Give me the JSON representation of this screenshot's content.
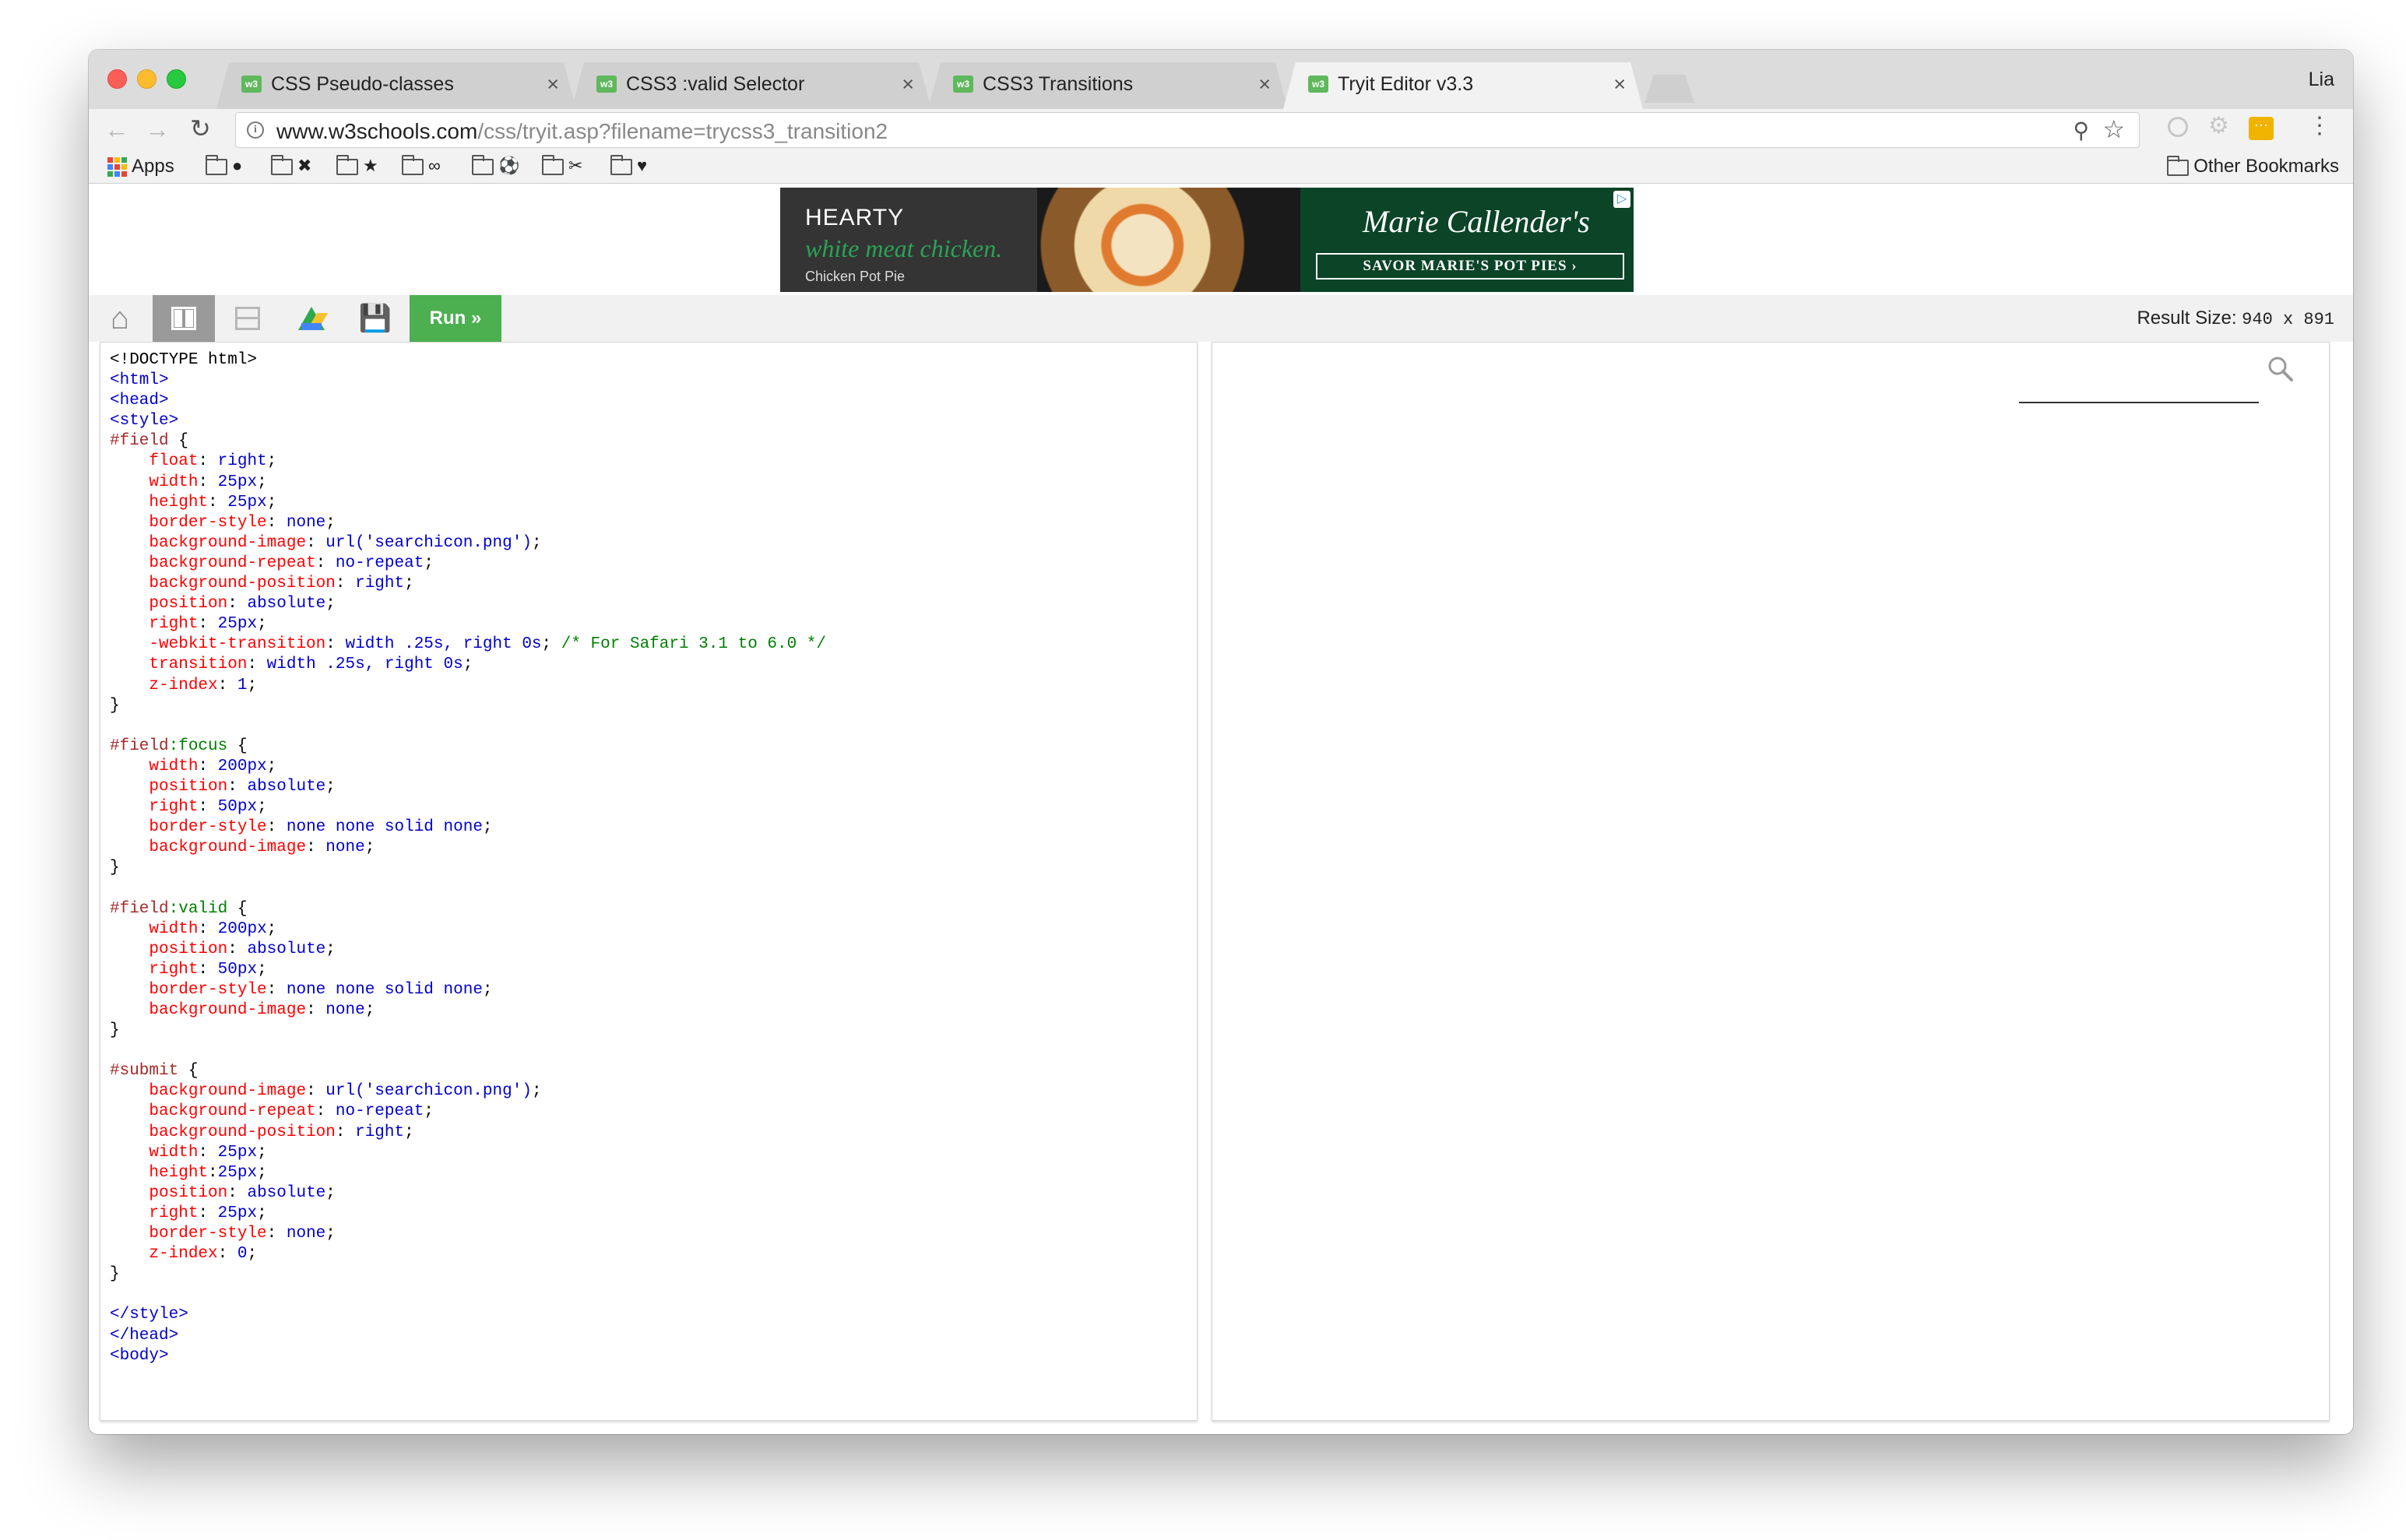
{
  "browser": {
    "tabs": [
      {
        "label": "CSS Pseudo-classes",
        "favicon": "w3",
        "close": "×"
      },
      {
        "label": "CSS3 :valid Selector",
        "favicon": "w3",
        "close": "×"
      },
      {
        "label": "CSS3 Transitions",
        "favicon": "w3",
        "close": "×"
      },
      {
        "label": "Tryit Editor v3.3",
        "favicon": "w3",
        "close": "×"
      }
    ],
    "active_tab": 3,
    "profile": "Lia",
    "url_host": "www.w3schools.com",
    "url_path": "/css/tryit.asp?filename=trycss3_transition2",
    "bookmarks": {
      "apps_label": "Apps",
      "folders": [
        {
          "glyph": "●"
        },
        {
          "glyph": "✖"
        },
        {
          "glyph": "★"
        },
        {
          "glyph": "∞"
        },
        {
          "glyph": "⚽"
        },
        {
          "glyph": "✂"
        },
        {
          "glyph": "♥"
        }
      ],
      "other_label": "Other Bookmarks"
    }
  },
  "ad": {
    "line1": "HEARTY",
    "line2": "white meat chicken.",
    "line3": "Chicken Pot Pie",
    "brand": "Marie Callender's",
    "cta": "SAVOR MARIE'S POT PIES ›"
  },
  "tryit": {
    "run_label": "Run »",
    "result_size_label": "Result Size:",
    "result_size_value": "940 x 891"
  },
  "code_lines": [
    [
      {
        "t": "<!DOCTYPE html>",
        "c": "plain"
      }
    ],
    [
      {
        "t": "<html>",
        "c": "tag"
      }
    ],
    [
      {
        "t": "<head>",
        "c": "tag"
      }
    ],
    [
      {
        "t": "<style>",
        "c": "tag"
      }
    ],
    [
      {
        "t": "#field",
        "c": "sel"
      },
      {
        "t": " {",
        "c": "plain"
      }
    ],
    [
      {
        "t": "    ",
        "c": "plain"
      },
      {
        "t": "float",
        "c": "prop"
      },
      {
        "t": ": ",
        "c": "plain"
      },
      {
        "t": "right",
        "c": "val"
      },
      {
        "t": ";",
        "c": "plain"
      }
    ],
    [
      {
        "t": "    ",
        "c": "plain"
      },
      {
        "t": "width",
        "c": "prop"
      },
      {
        "t": ": ",
        "c": "plain"
      },
      {
        "t": "25px",
        "c": "val"
      },
      {
        "t": ";",
        "c": "plain"
      }
    ],
    [
      {
        "t": "    ",
        "c": "plain"
      },
      {
        "t": "height",
        "c": "prop"
      },
      {
        "t": ": ",
        "c": "plain"
      },
      {
        "t": "25px",
        "c": "val"
      },
      {
        "t": ";",
        "c": "plain"
      }
    ],
    [
      {
        "t": "    ",
        "c": "plain"
      },
      {
        "t": "border-style",
        "c": "prop"
      },
      {
        "t": ": ",
        "c": "plain"
      },
      {
        "t": "none",
        "c": "val"
      },
      {
        "t": ";",
        "c": "plain"
      }
    ],
    [
      {
        "t": "    ",
        "c": "plain"
      },
      {
        "t": "background-image",
        "c": "prop"
      },
      {
        "t": ": ",
        "c": "plain"
      },
      {
        "t": "url('searchicon.png')",
        "c": "val"
      },
      {
        "t": ";",
        "c": "plain"
      }
    ],
    [
      {
        "t": "    ",
        "c": "plain"
      },
      {
        "t": "background-repeat",
        "c": "prop"
      },
      {
        "t": ": ",
        "c": "plain"
      },
      {
        "t": "no-repeat",
        "c": "val"
      },
      {
        "t": ";",
        "c": "plain"
      }
    ],
    [
      {
        "t": "    ",
        "c": "plain"
      },
      {
        "t": "background-position",
        "c": "prop"
      },
      {
        "t": ": ",
        "c": "plain"
      },
      {
        "t": "right",
        "c": "val"
      },
      {
        "t": ";",
        "c": "plain"
      }
    ],
    [
      {
        "t": "    ",
        "c": "plain"
      },
      {
        "t": "position",
        "c": "prop"
      },
      {
        "t": ": ",
        "c": "plain"
      },
      {
        "t": "absolute",
        "c": "val"
      },
      {
        "t": ";",
        "c": "plain"
      }
    ],
    [
      {
        "t": "    ",
        "c": "plain"
      },
      {
        "t": "right",
        "c": "prop"
      },
      {
        "t": ": ",
        "c": "plain"
      },
      {
        "t": "25px",
        "c": "val"
      },
      {
        "t": ";",
        "c": "plain"
      }
    ],
    [
      {
        "t": "    ",
        "c": "plain"
      },
      {
        "t": "-webkit-transition",
        "c": "prop"
      },
      {
        "t": ": ",
        "c": "plain"
      },
      {
        "t": "width .25s, right 0s",
        "c": "val"
      },
      {
        "t": "; ",
        "c": "plain"
      },
      {
        "t": "/* For Safari 3.1 to 6.0 */",
        "c": "com"
      }
    ],
    [
      {
        "t": "    ",
        "c": "plain"
      },
      {
        "t": "transition",
        "c": "prop"
      },
      {
        "t": ": ",
        "c": "plain"
      },
      {
        "t": "width .25s, right 0s",
        "c": "val"
      },
      {
        "t": ";",
        "c": "plain"
      }
    ],
    [
      {
        "t": "    ",
        "c": "plain"
      },
      {
        "t": "z-index",
        "c": "prop"
      },
      {
        "t": ": ",
        "c": "plain"
      },
      {
        "t": "1",
        "c": "val"
      },
      {
        "t": ";",
        "c": "plain"
      }
    ],
    [
      {
        "t": "}",
        "c": "plain"
      }
    ],
    [
      {
        "t": "",
        "c": "plain"
      }
    ],
    [
      {
        "t": "#field",
        "c": "sel"
      },
      {
        "t": ":focus",
        "c": "com"
      },
      {
        "t": " {",
        "c": "plain"
      }
    ],
    [
      {
        "t": "    ",
        "c": "plain"
      },
      {
        "t": "width",
        "c": "prop"
      },
      {
        "t": ": ",
        "c": "plain"
      },
      {
        "t": "200px",
        "c": "val"
      },
      {
        "t": ";",
        "c": "plain"
      }
    ],
    [
      {
        "t": "    ",
        "c": "plain"
      },
      {
        "t": "position",
        "c": "prop"
      },
      {
        "t": ": ",
        "c": "plain"
      },
      {
        "t": "absolute",
        "c": "val"
      },
      {
        "t": ";",
        "c": "plain"
      }
    ],
    [
      {
        "t": "    ",
        "c": "plain"
      },
      {
        "t": "right",
        "c": "prop"
      },
      {
        "t": ": ",
        "c": "plain"
      },
      {
        "t": "50px",
        "c": "val"
      },
      {
        "t": ";",
        "c": "plain"
      }
    ],
    [
      {
        "t": "    ",
        "c": "plain"
      },
      {
        "t": "border-style",
        "c": "prop"
      },
      {
        "t": ": ",
        "c": "plain"
      },
      {
        "t": "none none solid none",
        "c": "val"
      },
      {
        "t": ";",
        "c": "plain"
      }
    ],
    [
      {
        "t": "    ",
        "c": "plain"
      },
      {
        "t": "background-image",
        "c": "prop"
      },
      {
        "t": ": ",
        "c": "plain"
      },
      {
        "t": "none",
        "c": "val"
      },
      {
        "t": ";",
        "c": "plain"
      }
    ],
    [
      {
        "t": "}",
        "c": "plain"
      }
    ],
    [
      {
        "t": "",
        "c": "plain"
      }
    ],
    [
      {
        "t": "#field",
        "c": "sel"
      },
      {
        "t": ":valid",
        "c": "com"
      },
      {
        "t": " {",
        "c": "plain"
      }
    ],
    [
      {
        "t": "    ",
        "c": "plain"
      },
      {
        "t": "width",
        "c": "prop"
      },
      {
        "t": ": ",
        "c": "plain"
      },
      {
        "t": "200px",
        "c": "val"
      },
      {
        "t": ";",
        "c": "plain"
      }
    ],
    [
      {
        "t": "    ",
        "c": "plain"
      },
      {
        "t": "position",
        "c": "prop"
      },
      {
        "t": ": ",
        "c": "plain"
      },
      {
        "t": "absolute",
        "c": "val"
      },
      {
        "t": ";",
        "c": "plain"
      }
    ],
    [
      {
        "t": "    ",
        "c": "plain"
      },
      {
        "t": "right",
        "c": "prop"
      },
      {
        "t": ": ",
        "c": "plain"
      },
      {
        "t": "50px",
        "c": "val"
      },
      {
        "t": ";",
        "c": "plain"
      }
    ],
    [
      {
        "t": "    ",
        "c": "plain"
      },
      {
        "t": "border-style",
        "c": "prop"
      },
      {
        "t": ": ",
        "c": "plain"
      },
      {
        "t": "none none solid none",
        "c": "val"
      },
      {
        "t": ";",
        "c": "plain"
      }
    ],
    [
      {
        "t": "    ",
        "c": "plain"
      },
      {
        "t": "background-image",
        "c": "prop"
      },
      {
        "t": ": ",
        "c": "plain"
      },
      {
        "t": "none",
        "c": "val"
      },
      {
        "t": ";",
        "c": "plain"
      }
    ],
    [
      {
        "t": "}",
        "c": "plain"
      }
    ],
    [
      {
        "t": "",
        "c": "plain"
      }
    ],
    [
      {
        "t": "#submit",
        "c": "sel"
      },
      {
        "t": " {",
        "c": "plain"
      }
    ],
    [
      {
        "t": "    ",
        "c": "plain"
      },
      {
        "t": "background-image",
        "c": "prop"
      },
      {
        "t": ": ",
        "c": "plain"
      },
      {
        "t": "url('searchicon.png')",
        "c": "val"
      },
      {
        "t": ";",
        "c": "plain"
      }
    ],
    [
      {
        "t": "    ",
        "c": "plain"
      },
      {
        "t": "background-repeat",
        "c": "prop"
      },
      {
        "t": ": ",
        "c": "plain"
      },
      {
        "t": "no-repeat",
        "c": "val"
      },
      {
        "t": ";",
        "c": "plain"
      }
    ],
    [
      {
        "t": "    ",
        "c": "plain"
      },
      {
        "t": "background-position",
        "c": "prop"
      },
      {
        "t": ": ",
        "c": "plain"
      },
      {
        "t": "right",
        "c": "val"
      },
      {
        "t": ";",
        "c": "plain"
      }
    ],
    [
      {
        "t": "    ",
        "c": "plain"
      },
      {
        "t": "width",
        "c": "prop"
      },
      {
        "t": ": ",
        "c": "plain"
      },
      {
        "t": "25px",
        "c": "val"
      },
      {
        "t": ";",
        "c": "plain"
      }
    ],
    [
      {
        "t": "    ",
        "c": "plain"
      },
      {
        "t": "height",
        "c": "prop"
      },
      {
        "t": ":",
        "c": "plain"
      },
      {
        "t": "25px",
        "c": "val"
      },
      {
        "t": ";",
        "c": "plain"
      }
    ],
    [
      {
        "t": "    ",
        "c": "plain"
      },
      {
        "t": "position",
        "c": "prop"
      },
      {
        "t": ": ",
        "c": "plain"
      },
      {
        "t": "absolute",
        "c": "val"
      },
      {
        "t": ";",
        "c": "plain"
      }
    ],
    [
      {
        "t": "    ",
        "c": "plain"
      },
      {
        "t": "right",
        "c": "prop"
      },
      {
        "t": ": ",
        "c": "plain"
      },
      {
        "t": "25px",
        "c": "val"
      },
      {
        "t": ";",
        "c": "plain"
      }
    ],
    [
      {
        "t": "    ",
        "c": "plain"
      },
      {
        "t": "border-style",
        "c": "prop"
      },
      {
        "t": ": ",
        "c": "plain"
      },
      {
        "t": "none",
        "c": "val"
      },
      {
        "t": ";",
        "c": "plain"
      }
    ],
    [
      {
        "t": "    ",
        "c": "plain"
      },
      {
        "t": "z-index",
        "c": "prop"
      },
      {
        "t": ": ",
        "c": "plain"
      },
      {
        "t": "0",
        "c": "val"
      },
      {
        "t": ";",
        "c": "plain"
      }
    ],
    [
      {
        "t": "}",
        "c": "plain"
      }
    ],
    [
      {
        "t": "",
        "c": "plain"
      }
    ],
    [
      {
        "t": "</style>",
        "c": "tag"
      }
    ],
    [
      {
        "t": "</head>",
        "c": "tag"
      }
    ],
    [
      {
        "t": "<body>",
        "c": "tag"
      }
    ]
  ],
  "colors": {
    "run_green": "#4caf50",
    "code_tag": "#0000cd",
    "code_selector": "#a52a2a",
    "code_property": "#ff0000",
    "code_comment": "#008000"
  }
}
